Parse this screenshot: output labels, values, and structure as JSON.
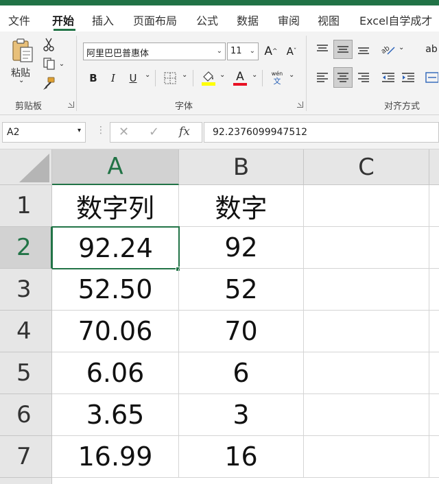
{
  "menu": {
    "tabs": [
      "文件",
      "开始",
      "插入",
      "页面布局",
      "公式",
      "数据",
      "审阅",
      "视图",
      "Excel自学成才"
    ],
    "active": "开始"
  },
  "ribbon": {
    "clipboard": {
      "paste_label": "粘贴",
      "group_label": "剪贴板"
    },
    "font": {
      "font_name": "阿里巴巴普惠体",
      "font_size": "11",
      "grow_label": "A",
      "shrink_label": "A",
      "bold": "B",
      "italic": "I",
      "underline": "U",
      "font_color_letter": "A",
      "phonetic_top": "wén",
      "phonetic_bottom": "文",
      "group_label": "字体"
    },
    "alignment": {
      "group_label": "对齐方式"
    },
    "partial_right": "ab"
  },
  "formula_bar": {
    "name_box": "A2",
    "fx": "fx",
    "value": "92.2376099947512"
  },
  "sheet": {
    "columns": [
      "A",
      "B",
      "C"
    ],
    "selected_column": "A",
    "rows": [
      {
        "row": "1",
        "A": "数字列",
        "B": "数字"
      },
      {
        "row": "2",
        "A": "92.24",
        "B": "92"
      },
      {
        "row": "3",
        "A": "52.50",
        "B": "52"
      },
      {
        "row": "4",
        "A": "70.06",
        "B": "70"
      },
      {
        "row": "5",
        "A": "6.06",
        "B": "6"
      },
      {
        "row": "6",
        "A": "3.65",
        "B": "3"
      },
      {
        "row": "7",
        "A": "16.99",
        "B": "16"
      }
    ],
    "active_cell": "A2",
    "colors": {
      "accent": "#217346",
      "header_bg": "#e6e6e6",
      "selected_header_bg": "#d2d2d2"
    }
  }
}
